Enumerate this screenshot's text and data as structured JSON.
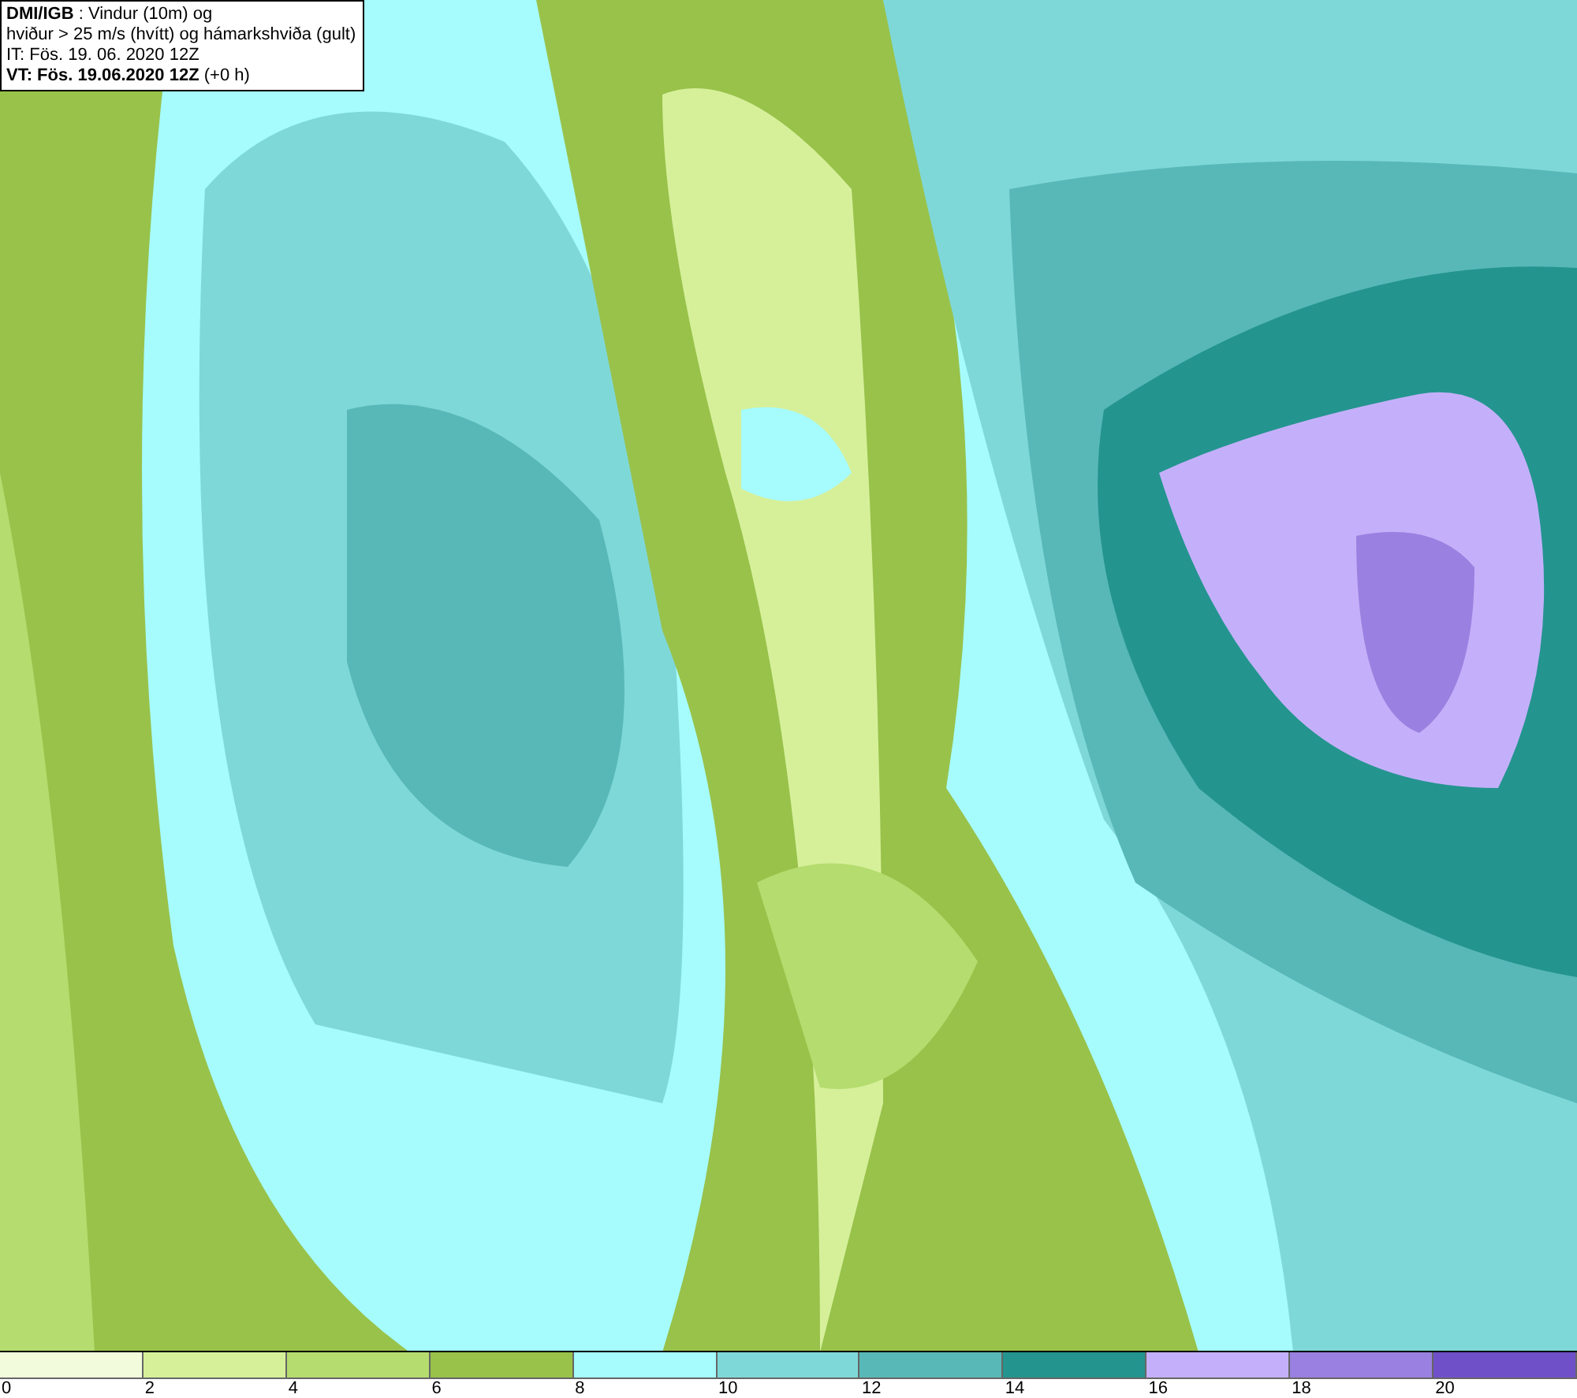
{
  "header": {
    "lines": [
      "**DMI/IGB** : Vindur (10m) og",
      "hviður > 25 m/s (hvítt) og hámarkshviða (gult)",
      "IT: Fös. 19. 06. 2020 12Z",
      "**VT: Fös. 19.06.2020 12Z** (+0 h)"
    ]
  },
  "legend": [
    {
      "color": "#f2fbdc",
      "label": "0"
    },
    {
      "color": "#d6f09a",
      "label": "2"
    },
    {
      "color": "#b5dc6e",
      "label": "4"
    },
    {
      "color": "#98c24a",
      "label": "6"
    },
    {
      "color": "#a6fbfc",
      "label": "8"
    },
    {
      "color": "#7fd8d8",
      "label": "10"
    },
    {
      "color": "#58b8b8",
      "label": "12"
    },
    {
      "color": "#24948f",
      "label": "14"
    },
    {
      "color": "#c4b0fa",
      "label": "16"
    },
    {
      "color": "#9a80e0",
      "label": "18"
    },
    {
      "color": "#7050c8",
      "label": "20"
    }
  ]
}
